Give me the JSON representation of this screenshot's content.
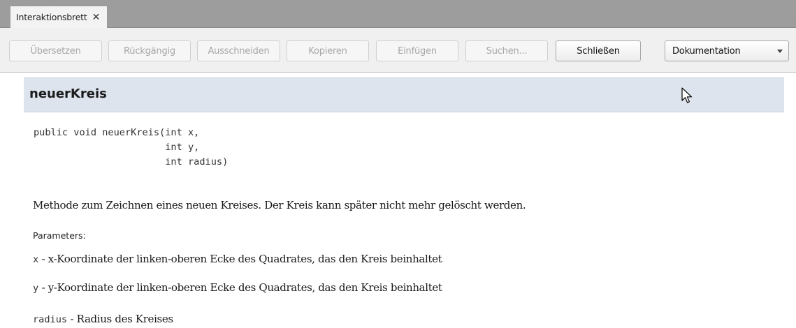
{
  "tab": {
    "label": "Interaktionsbrett",
    "close_glyph": "✕"
  },
  "toolbar": {
    "translate": "Übersetzen",
    "undo": "Rückgängig",
    "cut": "Ausschneiden",
    "copy": "Kopieren",
    "paste": "Einfügen",
    "find": "Suchen...",
    "close": "Schließen",
    "view_select": "Dokumentation"
  },
  "doc": {
    "method_name": "neuerKreis",
    "signature_line1": "public void neuerKreis(int x,",
    "signature_line2": "                       int y,",
    "signature_line3": "                       int radius)",
    "description": "Methode zum Zeichnen eines neuen Kreises. Der Kreis kann später nicht mehr gelöscht werden.",
    "parameters_label": "Parameters:",
    "params": [
      {
        "name": "x",
        "desc": " - x-Koordinate der linken-oberen Ecke des Quadrates, das den Kreis beinhaltet"
      },
      {
        "name": "y",
        "desc": " - y-Koordinate der linken-oberen Ecke des Quadrates, das den Kreis beinhaltet"
      },
      {
        "name": "radius",
        "desc": " - Radius des Kreises"
      }
    ]
  }
}
